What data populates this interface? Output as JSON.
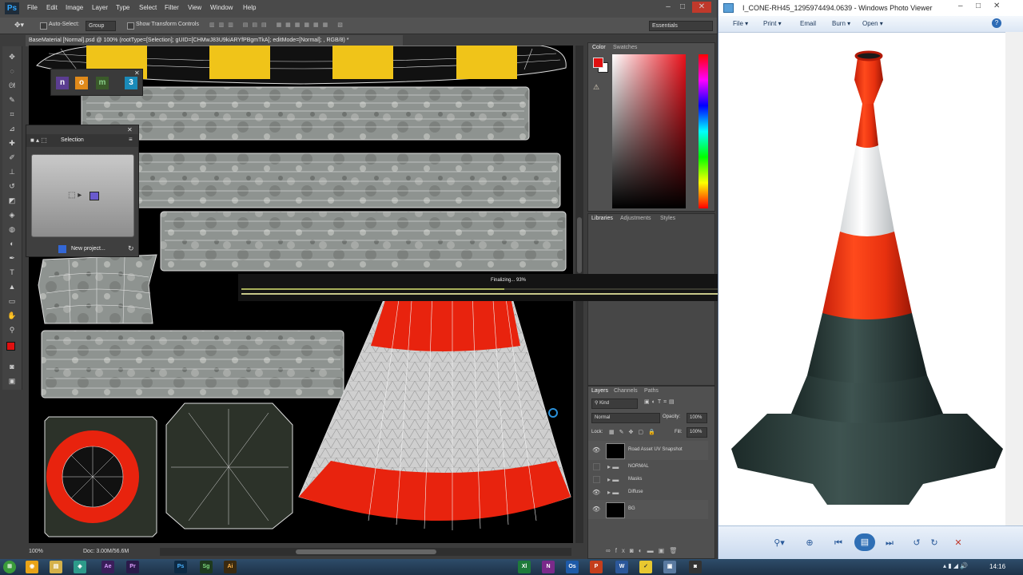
{
  "photoshop": {
    "logo": "Ps",
    "menu": [
      "File",
      "Edit",
      "Image",
      "Layer",
      "Type",
      "Select",
      "Filter",
      "View",
      "Window",
      "Help"
    ],
    "options": {
      "auto_select_label": "Auto-Select:",
      "auto_select_value": "Group",
      "show_transform_label": "Show Transform Controls",
      "workspace": "Essentials"
    },
    "doc_tab": "BaseMaterial [Normal].psd @ 100% (rootType=[Selection]; gUID=[CHMwJ83U9kiARYfPBgmTkA]; editMode=[Normal]; , RGB/8) *",
    "status": {
      "zoom": "100%",
      "doc": "Doc: 3.00M/56.6M"
    },
    "progress": {
      "label": "Finalizing... 93%",
      "percent": 93
    },
    "selection_panel": {
      "title": "Selection",
      "new_project": "New project..."
    },
    "plugins": [
      "n",
      "o",
      "m",
      "3"
    ],
    "color_panel": {
      "tabs": [
        "Color",
        "Swatches"
      ],
      "fg": "#e01010",
      "bg": "#ffffff"
    },
    "libraries_panel": {
      "tabs": [
        "Libraries",
        "Adjustments",
        "Styles"
      ]
    },
    "layers_panel": {
      "tabs": [
        "Layers",
        "Channels",
        "Paths"
      ],
      "kind": "Kind",
      "blend": "Normal",
      "opacity_label": "Opacity:",
      "opacity": "100%",
      "lock_label": "Lock:",
      "fill_label": "Fill:",
      "fill": "100%",
      "layers": [
        {
          "name": "Road Asset UV Snapshot",
          "visible": true,
          "type": "thumb"
        },
        {
          "name": "NORMAL",
          "visible": false,
          "type": "folder"
        },
        {
          "name": "Masks",
          "visible": false,
          "type": "folder"
        },
        {
          "name": "Diffuse",
          "visible": true,
          "type": "folder"
        },
        {
          "name": "BG",
          "visible": true,
          "type": "thumb"
        }
      ]
    }
  },
  "photo_viewer": {
    "title": "I_CONE-RH45_1295974494.0639 - Windows Photo Viewer",
    "menu": [
      "File",
      "Print",
      "Email",
      "Burn",
      "Open"
    ]
  },
  "taskbar": {
    "clock": "14:16",
    "apps": [
      "Ae",
      "Pr",
      "Ps",
      "Sg",
      "Ai",
      "Xl",
      "N",
      "Os",
      "P",
      "W"
    ]
  }
}
